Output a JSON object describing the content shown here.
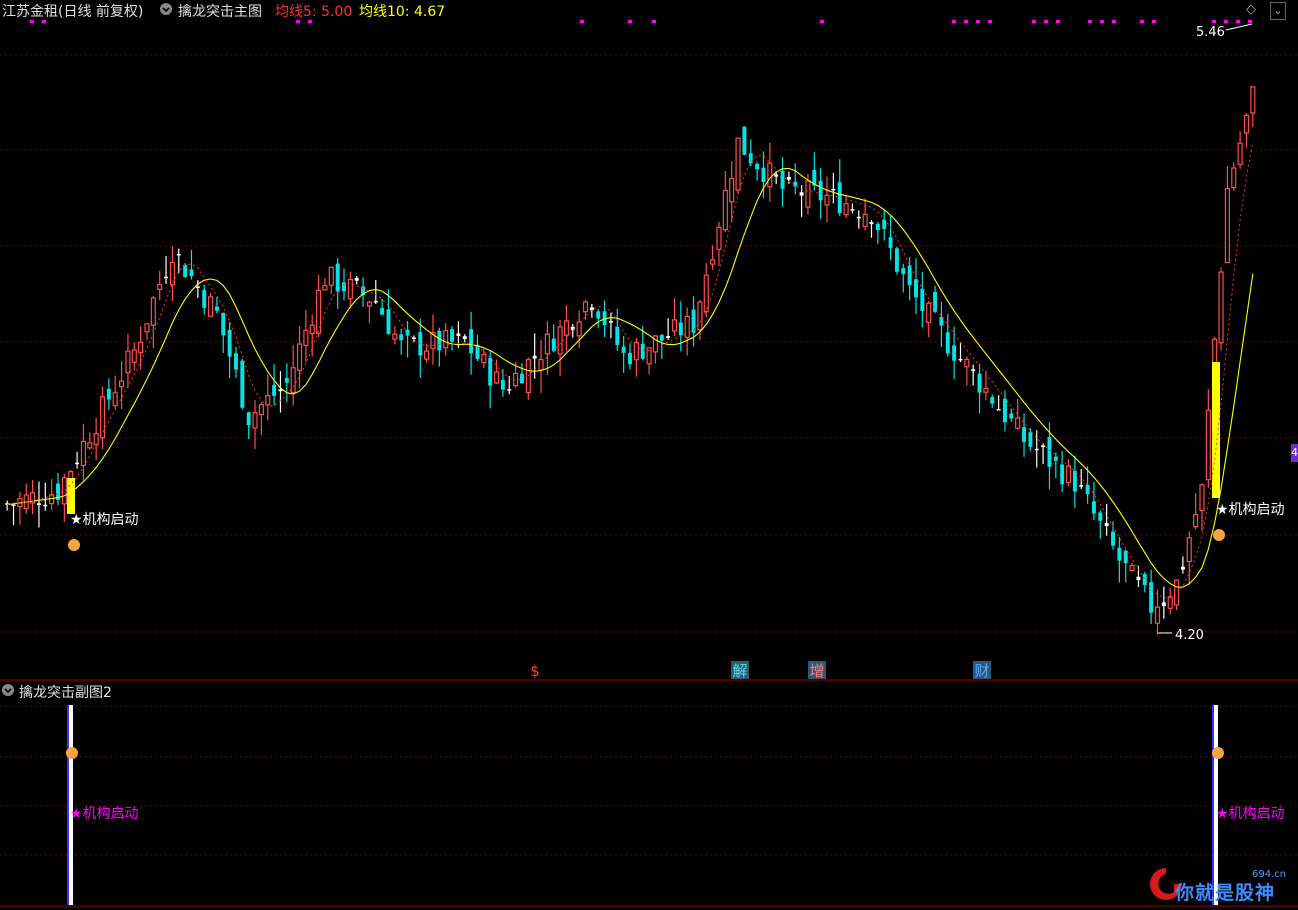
{
  "header": {
    "stock_name": "江苏金租(日线 前复权)",
    "main_indicator": "擒龙突击主图",
    "ma5_label": "均线5: 5.00",
    "ma10_label": "均线10: 4.67"
  },
  "sub_panel": {
    "title": "擒龙突击副图2",
    "signal_label": "★机构启动"
  },
  "annotations": {
    "signal_label": "★机构启动",
    "high_label": "5.46",
    "low_label": "4.20",
    "events": [
      "$",
      "解",
      "增",
      "财"
    ]
  },
  "right_edge_marker": "4",
  "watermark": {
    "site": "694.cn",
    "text": "你就是股神"
  },
  "colors": {
    "up": "#ff4d4d",
    "down": "#00e5e5",
    "doji": "#ffffff",
    "signal_bar": "#ffff00",
    "ma_line": "#ffff00",
    "magenta": "#ff00ff",
    "grid": "#7a0000"
  },
  "chart_data": {
    "type": "candlestick",
    "title": "擒龙突击主图",
    "high": 5.46,
    "low": 4.2,
    "series": [
      {
        "name": "均线5",
        "current": 5.0
      },
      {
        "name": "均线10",
        "current": 4.67
      }
    ],
    "signals": [
      {
        "label": "★机构启动",
        "bar_index": 8
      },
      {
        "label": "★机构启动",
        "bar_index": 151
      }
    ],
    "sub_chart": {
      "title": "擒龙突击副图2",
      "signal_bars": [
        8,
        151
      ]
    }
  }
}
